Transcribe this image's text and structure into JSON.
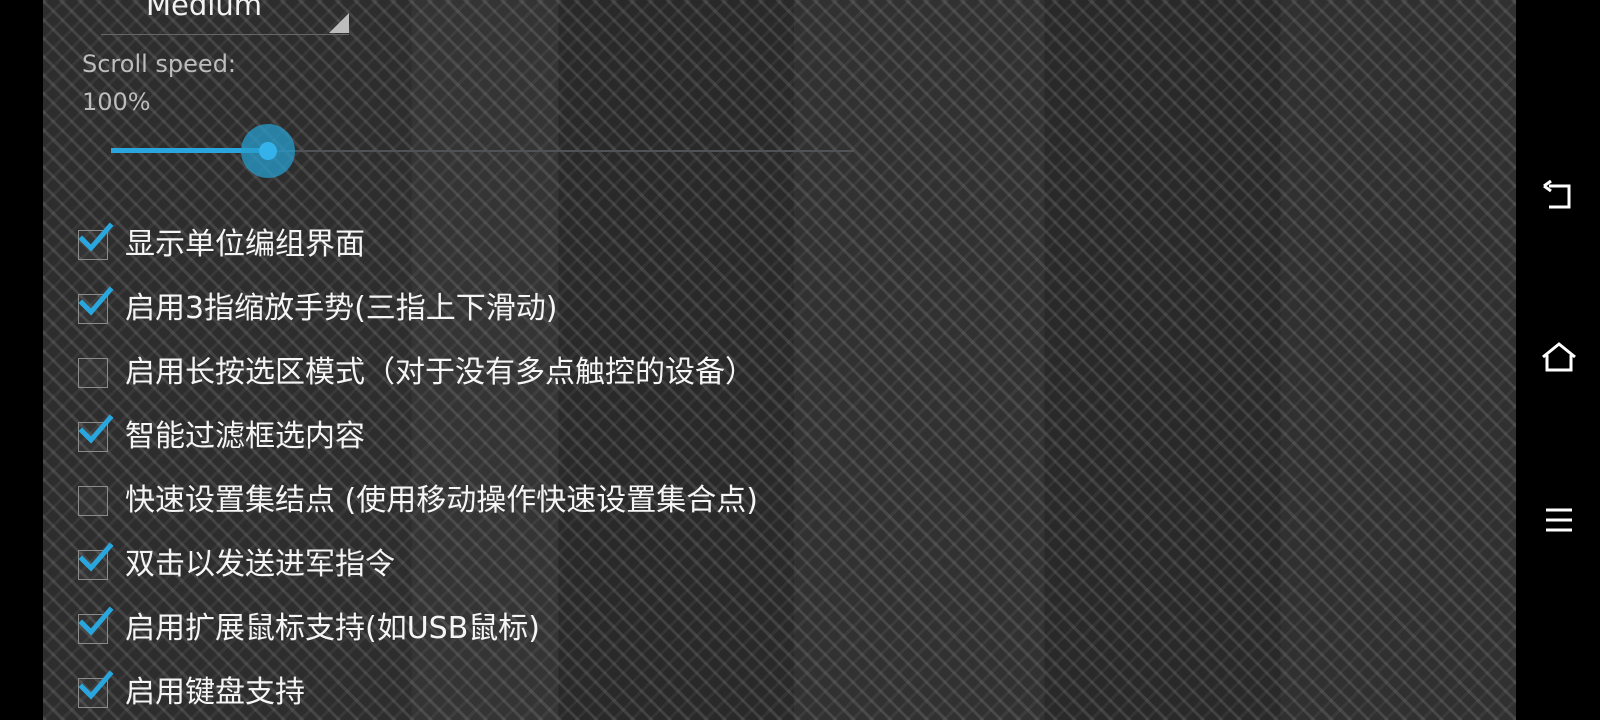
{
  "settings": {
    "dropdown_value": "Medium",
    "scroll_speed_label": "Scroll speed:",
    "scroll_speed_value": "100%",
    "scroll_speed_fraction": 0.2,
    "options": [
      {
        "label": "显示单位编组界面",
        "checked": true
      },
      {
        "label": "启用3指缩放手势(三指上下滑动)",
        "checked": true
      },
      {
        "label": "启用长按选区模式（对于没有多点触控的设备）",
        "checked": false
      },
      {
        "label": "智能过滤框选内容",
        "checked": true
      },
      {
        "label": "快速设置集结点 (使用移动操作快速设置集合点)",
        "checked": false
      },
      {
        "label": "双击以发送进军指令",
        "checked": true
      },
      {
        "label": "启用扩展鼠标支持(如USB鼠标)",
        "checked": true
      },
      {
        "label": "启用键盘支持",
        "checked": true
      }
    ]
  },
  "navbar": {
    "icons": [
      "back-icon",
      "home-icon",
      "menu-icon"
    ]
  },
  "colors": {
    "accent": "#2aa6df",
    "background": "#202020",
    "navbar": "#000000",
    "text": "#f5f5f5",
    "muted_text": "#bdbdbd"
  }
}
